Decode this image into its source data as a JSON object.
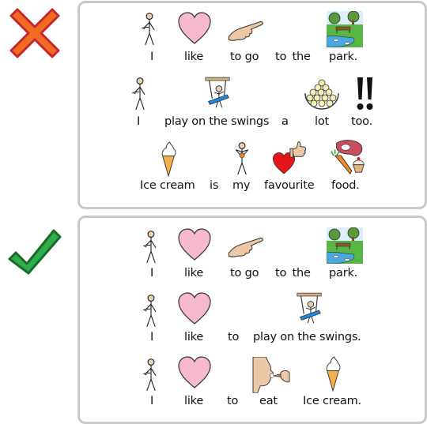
{
  "incorrect_panel": {
    "status_icon": "cross-icon",
    "sentences": [
      {
        "words": [
          "I",
          "like",
          "to go",
          "to  the",
          "park."
        ],
        "symbols": [
          "person-icon",
          "heart-icon",
          "pointing-hand-icon",
          "park-icon"
        ]
      },
      {
        "words": [
          "I",
          "play on the swings",
          "a",
          "lot",
          "too."
        ],
        "symbols": [
          "person-icon",
          "swing-icon",
          "pile-of-balls-icon",
          "double-exclamation-icon"
        ]
      },
      {
        "words": [
          "Ice cream",
          "is",
          "my",
          "favourite",
          "food."
        ],
        "symbols": [
          "ice-cream-icon",
          "person-holding-icon",
          "heart-thumbs-up-icon",
          "food-icon"
        ]
      }
    ]
  },
  "correct_panel": {
    "status_icon": "check-icon",
    "sentences": [
      {
        "words": [
          "I",
          "like",
          "to go",
          "to  the",
          "park."
        ],
        "symbols": [
          "person-icon",
          "heart-icon",
          "pointing-hand-icon",
          "park-icon"
        ]
      },
      {
        "words": [
          "I",
          "like",
          "to",
          "play on the swings."
        ],
        "symbols": [
          "person-icon",
          "heart-icon",
          "swing-icon"
        ]
      },
      {
        "words": [
          "I",
          "like",
          "to",
          "eat",
          "Ice cream."
        ],
        "symbols": [
          "person-icon",
          "heart-icon",
          "eating-icon",
          "ice-cream-icon"
        ]
      }
    ]
  },
  "colors": {
    "cross_fill": "#f26b22",
    "cross_stroke": "#c8262a",
    "check_fill": "#2fae4a",
    "check_stroke": "#1c6b2c",
    "heart_pink": "#f7b9cf",
    "heart_red": "#e8141b",
    "panel_border": "#c9c9c9"
  }
}
